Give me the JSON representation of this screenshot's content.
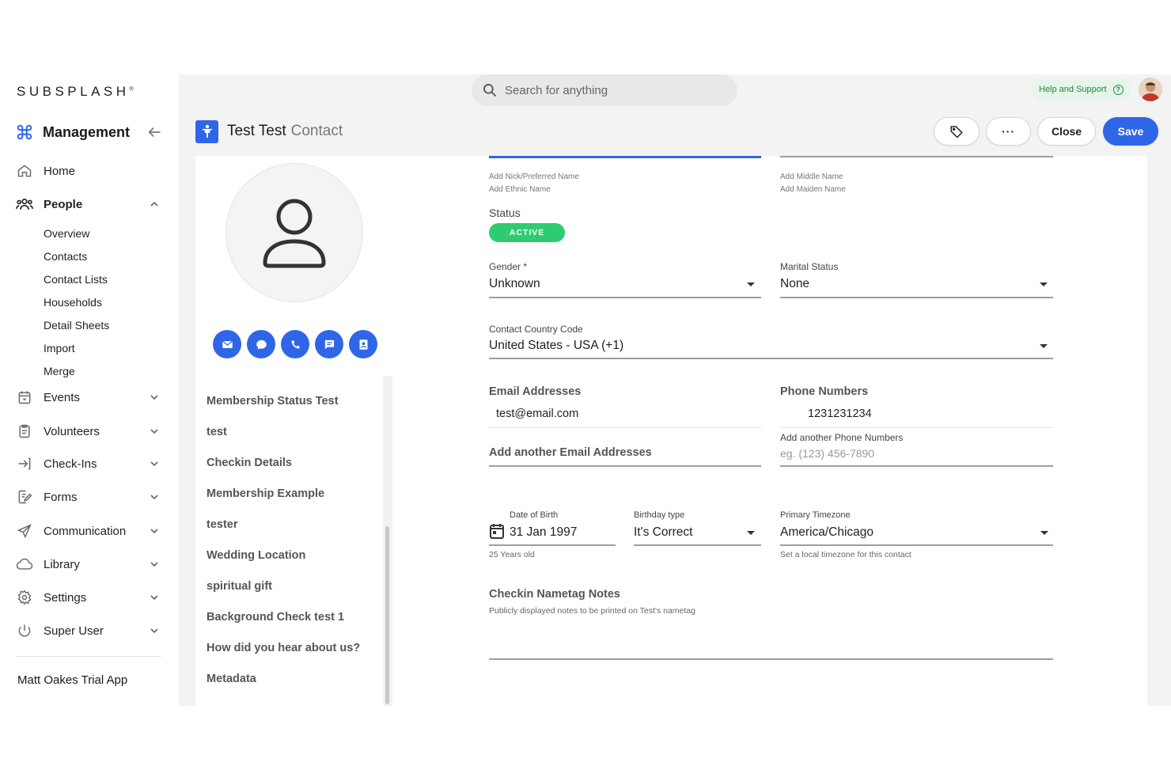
{
  "brand": {
    "logo_text": "SUBSPLASH",
    "logo_mark": "®"
  },
  "sidebar": {
    "section_title": "Management",
    "items": [
      {
        "label": "Home",
        "icon": "home-icon"
      },
      {
        "label": "People",
        "icon": "people-icon",
        "expanded": true,
        "children": [
          "Overview",
          "Contacts",
          "Contact Lists",
          "Households",
          "Detail Sheets",
          "Import",
          "Merge"
        ]
      },
      {
        "label": "Events",
        "icon": "calendar-icon"
      },
      {
        "label": "Volunteers",
        "icon": "clipboard-icon"
      },
      {
        "label": "Check-Ins",
        "icon": "check-in-icon"
      },
      {
        "label": "Forms",
        "icon": "form-icon"
      },
      {
        "label": "Communication",
        "icon": "send-icon"
      },
      {
        "label": "Library",
        "icon": "cloud-icon"
      },
      {
        "label": "Settings",
        "icon": "gear-icon"
      },
      {
        "label": "Super User",
        "icon": "power-icon"
      }
    ],
    "app_name": "Matt Oakes Trial App"
  },
  "topbar": {
    "search_placeholder": "Search for anything",
    "help_label": "Help and Support",
    "help_glyph": "?"
  },
  "page": {
    "contact_name": "Test Test",
    "record_type": "Contact",
    "buttons": {
      "more": "···",
      "close": "Close",
      "save": "Save"
    }
  },
  "profile": {
    "actions": [
      "email-icon",
      "chat-icon",
      "phone-icon",
      "message-icon",
      "contact-card-icon"
    ],
    "sections": [
      "Membership Status Test",
      "test",
      "Checkin Details",
      "Membership Example",
      "tester",
      "Wedding Location",
      "spiritual gift",
      "Background Check test 1",
      "How did you hear about us?",
      "Metadata"
    ]
  },
  "form": {
    "links": {
      "nick": "Add Nick/Preferred Name",
      "ethnic": "Add Ethnic Name",
      "middle": "Add Middle Name",
      "maiden": "Add Maiden Name"
    },
    "status_label": "Status",
    "status_value": "ACTIVE",
    "gender_label": "Gender *",
    "gender_value": "Unknown",
    "marital_label": "Marital Status",
    "marital_value": "None",
    "country_code_label": "Contact Country Code",
    "country_code_value": "United States - USA (+1)",
    "email_label": "Email Addresses",
    "email_value": "test@email.com",
    "email_add": "Add another Email Addresses",
    "phone_label": "Phone Numbers",
    "phone_value": "1231231234",
    "phone_add_label": "Add another Phone Numbers",
    "phone_placeholder": "eg. (123) 456-7890",
    "dob_label": "Date of Birth",
    "dob_value": "31 Jan 1997",
    "age_hint": "25 Years old",
    "birthday_type_label": "Birthday type",
    "birthday_type_value": "It's Correct",
    "timezone_label": "Primary Timezone",
    "timezone_value": "America/Chicago",
    "timezone_hint": "Set a local timezone for this contact",
    "nametag_label": "Checkin Nametag Notes",
    "nametag_hint": "Publicly displayed notes to be printed on Test's nametag"
  },
  "colors": {
    "accent": "#2f66e8",
    "status_active": "#2ecc71",
    "help_green": "#1f8a3b"
  }
}
